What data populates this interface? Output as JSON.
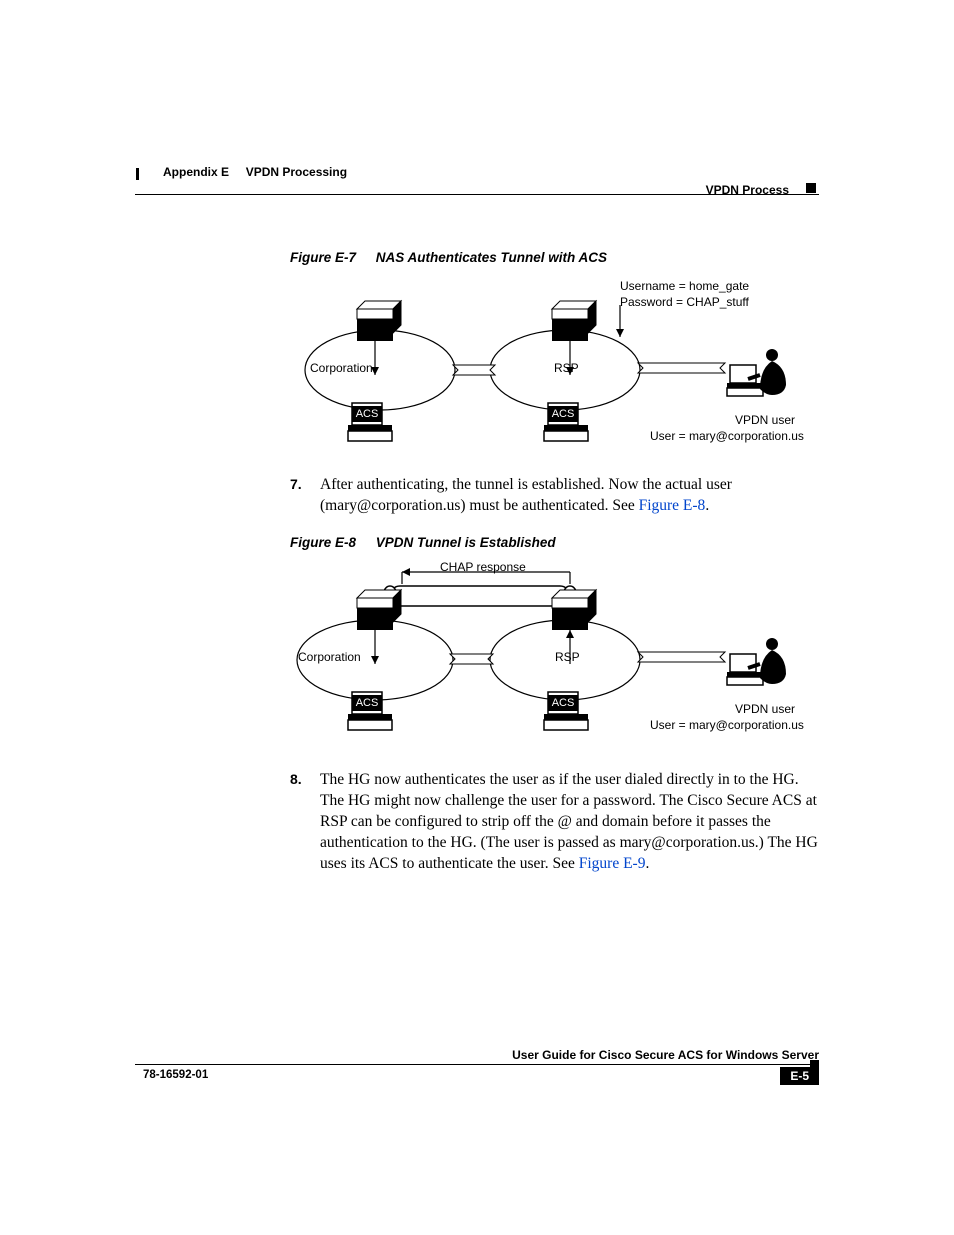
{
  "header": {
    "appendix_label": "Appendix E",
    "appendix_title": "VPDN Processing",
    "section_title": "VPDN Process"
  },
  "figure_e7": {
    "label": "Figure E-7",
    "title": "NAS Authenticates Tunnel with ACS",
    "username_line": "Username = home_gate",
    "password_line": "Password = CHAP_stuff",
    "cloud_left": "Corporation",
    "cloud_right": "RSP",
    "acs_label": "ACS",
    "vpdn_user_label": "VPDN user",
    "user_line": "User = mary@corporation.us"
  },
  "steps": {
    "s7": {
      "num": "7.",
      "text_a": "After authenticating, the tunnel is established. Now the actual user (mary@corporation.us) must be authenticated. See ",
      "xref": "Figure E-8",
      "text_b": "."
    },
    "s8": {
      "num": "8.",
      "text_a": "The HG now authenticates the user as if the user dialed directly in to the HG. The HG might now challenge the user for a password. The Cisco Secure ACS at RSP can be configured to strip off the @ and domain before it passes the authentication to the HG. (The user is passed as mary@corporation.us.) The HG uses its ACS to authenticate the user. See ",
      "xref": "Figure E-9",
      "text_b": "."
    }
  },
  "figure_e8": {
    "label": "Figure E-8",
    "title": "VPDN Tunnel is Established",
    "top_label": "CHAP response",
    "cloud_left": "Corporation",
    "cloud_right": "RSP",
    "acs_label": "ACS",
    "vpdn_user_label": "VPDN user",
    "user_line": "User = mary@corporation.us"
  },
  "footer": {
    "guide_title": "User Guide for Cisco Secure ACS for Windows Server",
    "doc_number": "78-16592-01",
    "page_number": "E-5"
  }
}
